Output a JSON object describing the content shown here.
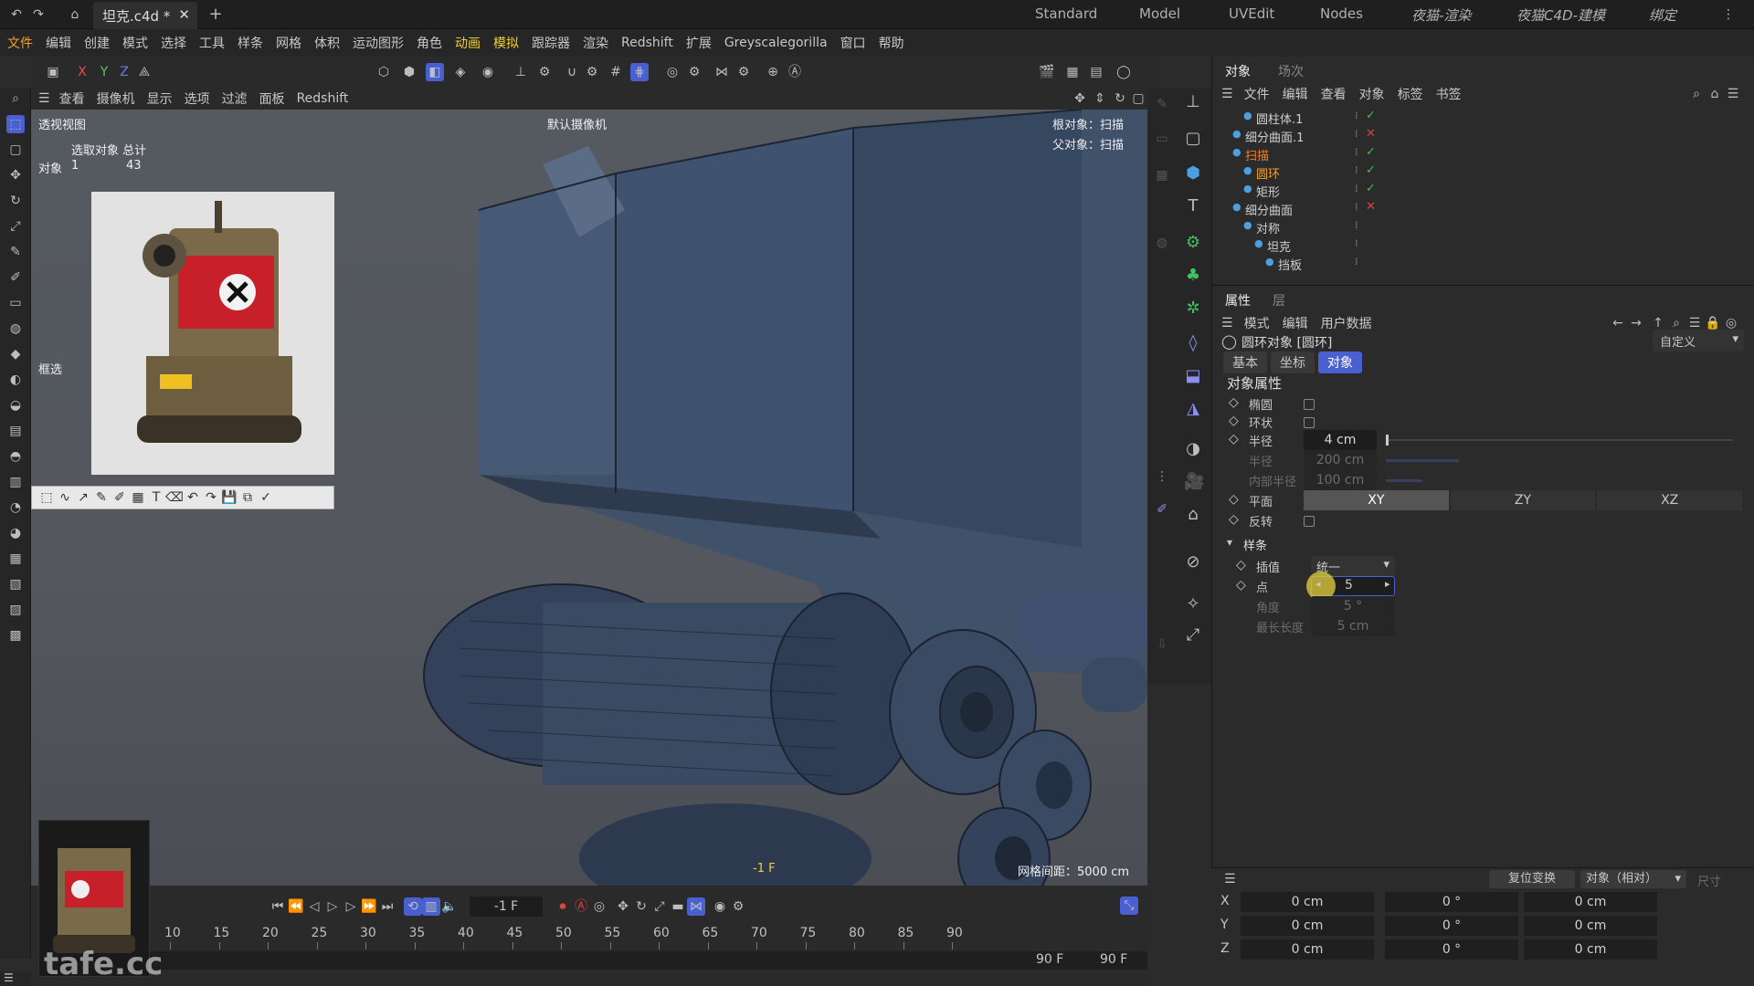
{
  "titlebar": {
    "doc_tab": "坦克.c4d *",
    "layouts": [
      "Standard",
      "Model",
      "UVEdit",
      "Nodes",
      "夜猫-渲染",
      "夜猫C4D-建模",
      "绑定"
    ]
  },
  "menubar": [
    "文件",
    "编辑",
    "创建",
    "模式",
    "选择",
    "工具",
    "样条",
    "网格",
    "体积",
    "运动图形",
    "角色",
    "动画",
    "模拟",
    "跟踪器",
    "渲染",
    "Redshift",
    "扩展",
    "Greyscalegorilla",
    "窗口",
    "帮助"
  ],
  "toolbar": {
    "x_axis": "X",
    "y_axis": "Y",
    "z_axis": "Z"
  },
  "viewport_menu": [
    "查看",
    "摄像机",
    "显示",
    "选项",
    "过滤",
    "面板",
    "Redshift"
  ],
  "viewport": {
    "view_name": "透视视图",
    "camera": "默认摄像机",
    "selection_header": "选取对象 总计",
    "selection_label": "对象",
    "selection_count": "1",
    "selection_total": "43",
    "box_select": "框选",
    "root_object": "根对象：扫描",
    "parent_object": "父对象：扫描",
    "grid_spacing": "网格间距：5000 cm",
    "frame_marker": "-1 F"
  },
  "object_manager": {
    "tabs": [
      "对象",
      "场次"
    ],
    "menu": [
      "文件",
      "编辑",
      "查看",
      "对象",
      "标签",
      "书签"
    ],
    "items": [
      {
        "name": "圆柱体.1",
        "indent": 1,
        "status": "check",
        "color": "#d0d0d0"
      },
      {
        "name": "细分曲面.1",
        "indent": 0,
        "status": "cross",
        "color": "#d0d0d0"
      },
      {
        "name": "扫描",
        "indent": 0,
        "status": "check",
        "color": "#f08030"
      },
      {
        "name": "圆环",
        "indent": 1,
        "status": "check",
        "color": "#f0a030"
      },
      {
        "name": "矩形",
        "indent": 1,
        "status": "check",
        "color": "#d0d0d0"
      },
      {
        "name": "细分曲面",
        "indent": 0,
        "status": "cross",
        "color": "#d0d0d0"
      },
      {
        "name": "对称",
        "indent": 1,
        "status": "",
        "color": "#d0d0d0"
      },
      {
        "name": "坦克",
        "indent": 2,
        "status": "",
        "color": "#d0d0d0"
      },
      {
        "name": "挡板",
        "indent": 3,
        "status": "",
        "color": "#d0d0d0"
      }
    ]
  },
  "attributes": {
    "tabs": [
      "属性",
      "层"
    ],
    "menu": [
      "模式",
      "编辑",
      "用户数据"
    ],
    "object_title": "圆环对象 [圆环]",
    "preset": "自定义",
    "subtabs": [
      "基本",
      "坐标",
      "对象"
    ],
    "active_subtab": "对象",
    "section": "对象属性",
    "ellipse": "椭圆",
    "ring": "环状",
    "radius_label": "半径",
    "radius_value": "4 cm",
    "radius2_label": "半径",
    "radius2_value": "200 cm",
    "inner_radius_label": "内部半径",
    "inner_radius_value": "100 cm",
    "plane_label": "平面",
    "planes": [
      "XY",
      "ZY",
      "XZ"
    ],
    "reverse_label": "反转",
    "spline_section": "样条",
    "interp_label": "插值",
    "interp_value": "统一",
    "points_label": "点",
    "points_value": "5",
    "angle_label": "角度",
    "angle_value": "5 °",
    "maxlen_label": "最长长度",
    "maxlen_value": "5 cm"
  },
  "coords": {
    "reset_button": "复位变换",
    "mode": "对象（相对）",
    "size_label": "尺寸",
    "rows": [
      {
        "axis": "X",
        "pos": "0 cm",
        "rot": "0 °",
        "size": "0 cm"
      },
      {
        "axis": "Y",
        "pos": "0 cm",
        "rot": "0 °",
        "size": "0 cm"
      },
      {
        "axis": "Z",
        "pos": "0 cm",
        "rot": "0 °",
        "size": "0 cm"
      }
    ]
  },
  "timeline": {
    "current_frame": "-1 F",
    "ruler": [
      "10",
      "15",
      "20",
      "25",
      "30",
      "35",
      "40",
      "45",
      "50",
      "55",
      "60",
      "65",
      "70",
      "75",
      "80",
      "85",
      "90"
    ],
    "end_frame_a": "90 F",
    "end_frame_b": "90 F"
  },
  "watermark": "tafe.cc",
  "colors": {
    "accent": "#4a5fd0",
    "check": "#39c24a",
    "cross": "#e04040",
    "highlight": "#f08030"
  }
}
